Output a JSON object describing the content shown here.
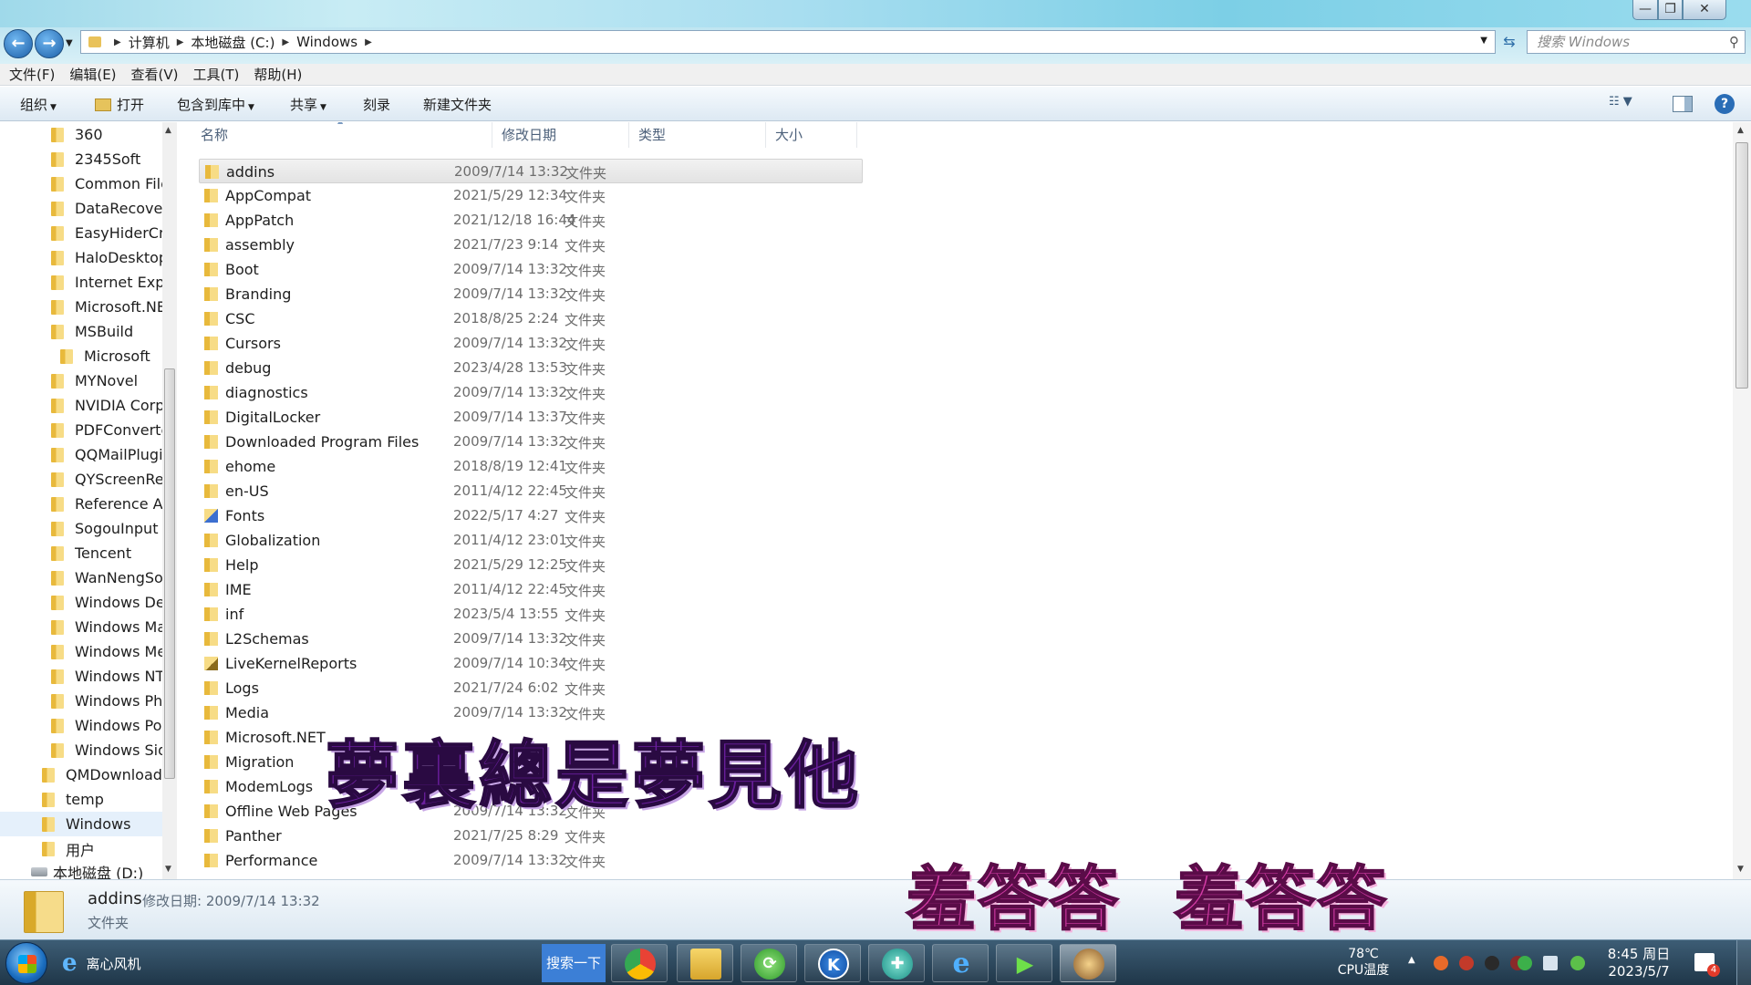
{
  "window": {
    "min_glyph": "—",
    "max_glyph": "❐",
    "close_glyph": "✕"
  },
  "address": {
    "crumbs": [
      "计算机",
      "本地磁盘 (C:)",
      "Windows"
    ],
    "search_placeholder": "搜索 Windows"
  },
  "menu": [
    "文件(F)",
    "编辑(E)",
    "查看(V)",
    "工具(T)",
    "帮助(H)"
  ],
  "toolbar": {
    "organize": "组织",
    "open": "打开",
    "include_library": "包含到库中",
    "share": "共享",
    "burn": "刻录",
    "new_folder": "新建文件夹"
  },
  "nav": {
    "items": [
      "360",
      "2345Soft",
      "Common Files",
      "DataRecovery",
      "EasyHiderCrack",
      "HaloDesktop",
      "Internet Explorer",
      "Microsoft.NET",
      "MSBuild",
      "Microsoft",
      "MYNovel",
      "NVIDIA Corporation",
      "PDFConverter",
      "QQMailPlugin",
      "QYScreenRecord",
      "Reference Assemblies",
      "SogouInput",
      "Tencent",
      "WanNengSoft",
      "Windows Defender",
      "Windows Mail",
      "Windows Media Player",
      "Windows NT",
      "Windows Photo Viewer",
      "Windows Portable Devices",
      "Windows Sidebar",
      "QMDownload",
      "temp",
      "Windows",
      "用户",
      "本地磁盘 (D:)"
    ]
  },
  "columns": {
    "name": "名称",
    "modified": "修改日期",
    "type": "类型",
    "size": "大小"
  },
  "files": [
    {
      "name": "addins",
      "date": "2009/7/14 13:32",
      "type": "文件夹"
    },
    {
      "name": "AppCompat",
      "date": "2021/5/29 12:34",
      "type": "文件夹"
    },
    {
      "name": "AppPatch",
      "date": "2021/12/18 16:44",
      "type": "文件夹"
    },
    {
      "name": "assembly",
      "date": "2021/7/23 9:14",
      "type": "文件夹"
    },
    {
      "name": "Boot",
      "date": "2009/7/14 13:32",
      "type": "文件夹"
    },
    {
      "name": "Branding",
      "date": "2009/7/14 13:32",
      "type": "文件夹"
    },
    {
      "name": "CSC",
      "date": "2018/8/25 2:24",
      "type": "文件夹"
    },
    {
      "name": "Cursors",
      "date": "2009/7/14 13:32",
      "type": "文件夹"
    },
    {
      "name": "debug",
      "date": "2023/4/28 13:53",
      "type": "文件夹"
    },
    {
      "name": "diagnostics",
      "date": "2009/7/14 13:32",
      "type": "文件夹"
    },
    {
      "name": "DigitalLocker",
      "date": "2009/7/14 13:37",
      "type": "文件夹"
    },
    {
      "name": "Downloaded Program Files",
      "date": "2009/7/14 13:32",
      "type": "文件夹"
    },
    {
      "name": "ehome",
      "date": "2018/8/19 12:41",
      "type": "文件夹"
    },
    {
      "name": "en-US",
      "date": "2011/4/12 22:45",
      "type": "文件夹"
    },
    {
      "name": "Fonts",
      "date": "2022/5/17 4:27",
      "type": "文件夹"
    },
    {
      "name": "Globalization",
      "date": "2011/4/12 23:01",
      "type": "文件夹"
    },
    {
      "name": "Help",
      "date": "2021/5/29 12:25",
      "type": "文件夹"
    },
    {
      "name": "IME",
      "date": "2011/4/12 22:45",
      "type": "文件夹"
    },
    {
      "name": "inf",
      "date": "2023/5/4 13:55",
      "type": "文件夹"
    },
    {
      "name": "L2Schemas",
      "date": "2009/7/14 13:32",
      "type": "文件夹"
    },
    {
      "name": "LiveKernelReports",
      "date": "2009/7/14 10:34",
      "type": "文件夹"
    },
    {
      "name": "Logs",
      "date": "2021/7/24 6:02",
      "type": "文件夹"
    },
    {
      "name": "Media",
      "date": "2009/7/14 13:32",
      "type": "文件夹"
    },
    {
      "name": "Microsoft.NET",
      "date": "",
      "type": ""
    },
    {
      "name": "Migration",
      "date": "",
      "type": ""
    },
    {
      "name": "ModemLogs",
      "date": "",
      "type": ""
    },
    {
      "name": "Offline Web Pages",
      "date": "2009/7/14 13:32",
      "type": "文件夹"
    },
    {
      "name": "Panther",
      "date": "2021/7/25 8:29",
      "type": "文件夹"
    },
    {
      "name": "Performance",
      "date": "2009/7/14 13:32",
      "type": "文件夹"
    }
  ],
  "details": {
    "name": "addins",
    "modified_label": "修改日期: 2009/7/14 13:32",
    "type": "文件夹"
  },
  "overlay": {
    "caption1": "夢裏總是夢見他",
    "caption2a": "羞答答",
    "caption2b": "羞答答"
  },
  "taskbar": {
    "ie_label": "离心风机",
    "search_button": "搜索一下",
    "temp_value": "78℃",
    "temp_label": "CPU温度",
    "clock_time": "8:45 周日",
    "clock_date": "2023/5/7",
    "notif_count": "4"
  }
}
